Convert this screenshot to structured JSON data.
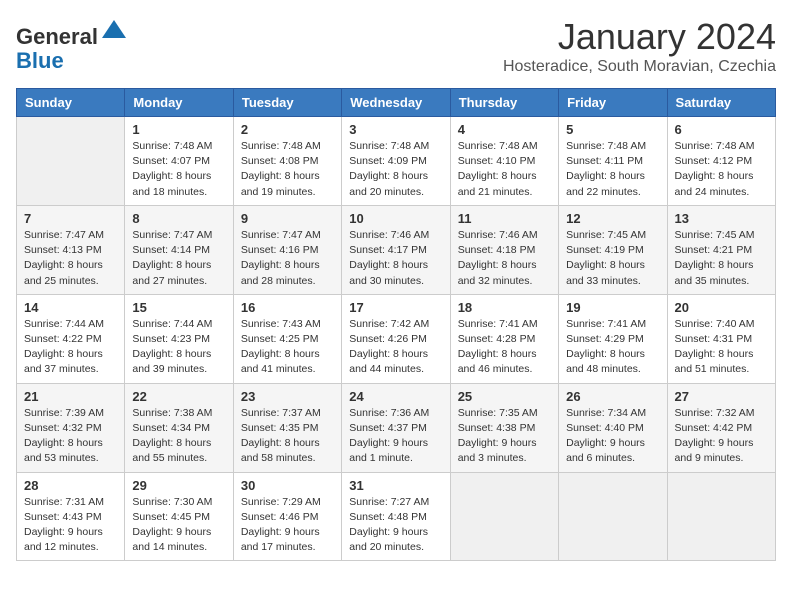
{
  "header": {
    "logo_general": "General",
    "logo_blue": "Blue",
    "month_title": "January 2024",
    "subtitle": "Hosteradice, South Moravian, Czechia"
  },
  "weekdays": [
    "Sunday",
    "Monday",
    "Tuesday",
    "Wednesday",
    "Thursday",
    "Friday",
    "Saturday"
  ],
  "weeks": [
    [
      {
        "day": "",
        "content": ""
      },
      {
        "day": "1",
        "content": "Sunrise: 7:48 AM\nSunset: 4:07 PM\nDaylight: 8 hours and 18 minutes."
      },
      {
        "day": "2",
        "content": "Sunrise: 7:48 AM\nSunset: 4:08 PM\nDaylight: 8 hours and 19 minutes."
      },
      {
        "day": "3",
        "content": "Sunrise: 7:48 AM\nSunset: 4:09 PM\nDaylight: 8 hours and 20 minutes."
      },
      {
        "day": "4",
        "content": "Sunrise: 7:48 AM\nSunset: 4:10 PM\nDaylight: 8 hours and 21 minutes."
      },
      {
        "day": "5",
        "content": "Sunrise: 7:48 AM\nSunset: 4:11 PM\nDaylight: 8 hours and 22 minutes."
      },
      {
        "day": "6",
        "content": "Sunrise: 7:48 AM\nSunset: 4:12 PM\nDaylight: 8 hours and 24 minutes."
      }
    ],
    [
      {
        "day": "7",
        "content": "Sunrise: 7:47 AM\nSunset: 4:13 PM\nDaylight: 8 hours and 25 minutes."
      },
      {
        "day": "8",
        "content": "Sunrise: 7:47 AM\nSunset: 4:14 PM\nDaylight: 8 hours and 27 minutes."
      },
      {
        "day": "9",
        "content": "Sunrise: 7:47 AM\nSunset: 4:16 PM\nDaylight: 8 hours and 28 minutes."
      },
      {
        "day": "10",
        "content": "Sunrise: 7:46 AM\nSunset: 4:17 PM\nDaylight: 8 hours and 30 minutes."
      },
      {
        "day": "11",
        "content": "Sunrise: 7:46 AM\nSunset: 4:18 PM\nDaylight: 8 hours and 32 minutes."
      },
      {
        "day": "12",
        "content": "Sunrise: 7:45 AM\nSunset: 4:19 PM\nDaylight: 8 hours and 33 minutes."
      },
      {
        "day": "13",
        "content": "Sunrise: 7:45 AM\nSunset: 4:21 PM\nDaylight: 8 hours and 35 minutes."
      }
    ],
    [
      {
        "day": "14",
        "content": "Sunrise: 7:44 AM\nSunset: 4:22 PM\nDaylight: 8 hours and 37 minutes."
      },
      {
        "day": "15",
        "content": "Sunrise: 7:44 AM\nSunset: 4:23 PM\nDaylight: 8 hours and 39 minutes."
      },
      {
        "day": "16",
        "content": "Sunrise: 7:43 AM\nSunset: 4:25 PM\nDaylight: 8 hours and 41 minutes."
      },
      {
        "day": "17",
        "content": "Sunrise: 7:42 AM\nSunset: 4:26 PM\nDaylight: 8 hours and 44 minutes."
      },
      {
        "day": "18",
        "content": "Sunrise: 7:41 AM\nSunset: 4:28 PM\nDaylight: 8 hours and 46 minutes."
      },
      {
        "day": "19",
        "content": "Sunrise: 7:41 AM\nSunset: 4:29 PM\nDaylight: 8 hours and 48 minutes."
      },
      {
        "day": "20",
        "content": "Sunrise: 7:40 AM\nSunset: 4:31 PM\nDaylight: 8 hours and 51 minutes."
      }
    ],
    [
      {
        "day": "21",
        "content": "Sunrise: 7:39 AM\nSunset: 4:32 PM\nDaylight: 8 hours and 53 minutes."
      },
      {
        "day": "22",
        "content": "Sunrise: 7:38 AM\nSunset: 4:34 PM\nDaylight: 8 hours and 55 minutes."
      },
      {
        "day": "23",
        "content": "Sunrise: 7:37 AM\nSunset: 4:35 PM\nDaylight: 8 hours and 58 minutes."
      },
      {
        "day": "24",
        "content": "Sunrise: 7:36 AM\nSunset: 4:37 PM\nDaylight: 9 hours and 1 minute."
      },
      {
        "day": "25",
        "content": "Sunrise: 7:35 AM\nSunset: 4:38 PM\nDaylight: 9 hours and 3 minutes."
      },
      {
        "day": "26",
        "content": "Sunrise: 7:34 AM\nSunset: 4:40 PM\nDaylight: 9 hours and 6 minutes."
      },
      {
        "day": "27",
        "content": "Sunrise: 7:32 AM\nSunset: 4:42 PM\nDaylight: 9 hours and 9 minutes."
      }
    ],
    [
      {
        "day": "28",
        "content": "Sunrise: 7:31 AM\nSunset: 4:43 PM\nDaylight: 9 hours and 12 minutes."
      },
      {
        "day": "29",
        "content": "Sunrise: 7:30 AM\nSunset: 4:45 PM\nDaylight: 9 hours and 14 minutes."
      },
      {
        "day": "30",
        "content": "Sunrise: 7:29 AM\nSunset: 4:46 PM\nDaylight: 9 hours and 17 minutes."
      },
      {
        "day": "31",
        "content": "Sunrise: 7:27 AM\nSunset: 4:48 PM\nDaylight: 9 hours and 20 minutes."
      },
      {
        "day": "",
        "content": ""
      },
      {
        "day": "",
        "content": ""
      },
      {
        "day": "",
        "content": ""
      }
    ]
  ]
}
